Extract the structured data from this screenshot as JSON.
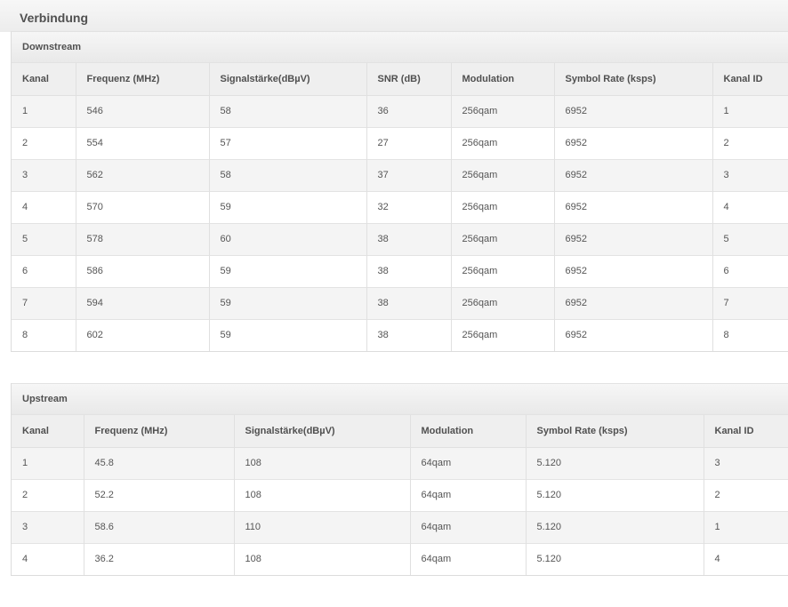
{
  "page": {
    "title": "Verbindung"
  },
  "downstream": {
    "title": "Downstream",
    "columns": [
      "Kanal",
      "Frequenz (MHz)",
      "Signalstärke(dBµV)",
      "SNR (dB)",
      "Modulation",
      "Symbol Rate (ksps)",
      "Kanal ID"
    ],
    "rows": [
      [
        "1",
        "546",
        "58",
        "36",
        "256qam",
        "6952",
        "1"
      ],
      [
        "2",
        "554",
        "57",
        "27",
        "256qam",
        "6952",
        "2"
      ],
      [
        "3",
        "562",
        "58",
        "37",
        "256qam",
        "6952",
        "3"
      ],
      [
        "4",
        "570",
        "59",
        "32",
        "256qam",
        "6952",
        "4"
      ],
      [
        "5",
        "578",
        "60",
        "38",
        "256qam",
        "6952",
        "5"
      ],
      [
        "6",
        "586",
        "59",
        "38",
        "256qam",
        "6952",
        "6"
      ],
      [
        "7",
        "594",
        "59",
        "38",
        "256qam",
        "6952",
        "7"
      ],
      [
        "8",
        "602",
        "59",
        "38",
        "256qam",
        "6952",
        "8"
      ]
    ]
  },
  "upstream": {
    "title": "Upstream",
    "columns": [
      "Kanal",
      "Frequenz (MHz)",
      "Signalstärke(dBµV)",
      "Modulation",
      "Symbol Rate (ksps)",
      "Kanal ID"
    ],
    "rows": [
      [
        "1",
        "45.8",
        "108",
        "64qam",
        "5.120",
        "3"
      ],
      [
        "2",
        "52.2",
        "108",
        "64qam",
        "5.120",
        "2"
      ],
      [
        "3",
        "58.6",
        "110",
        "64qam",
        "5.120",
        "1"
      ],
      [
        "4",
        "36.2",
        "108",
        "64qam",
        "5.120",
        "4"
      ]
    ]
  }
}
